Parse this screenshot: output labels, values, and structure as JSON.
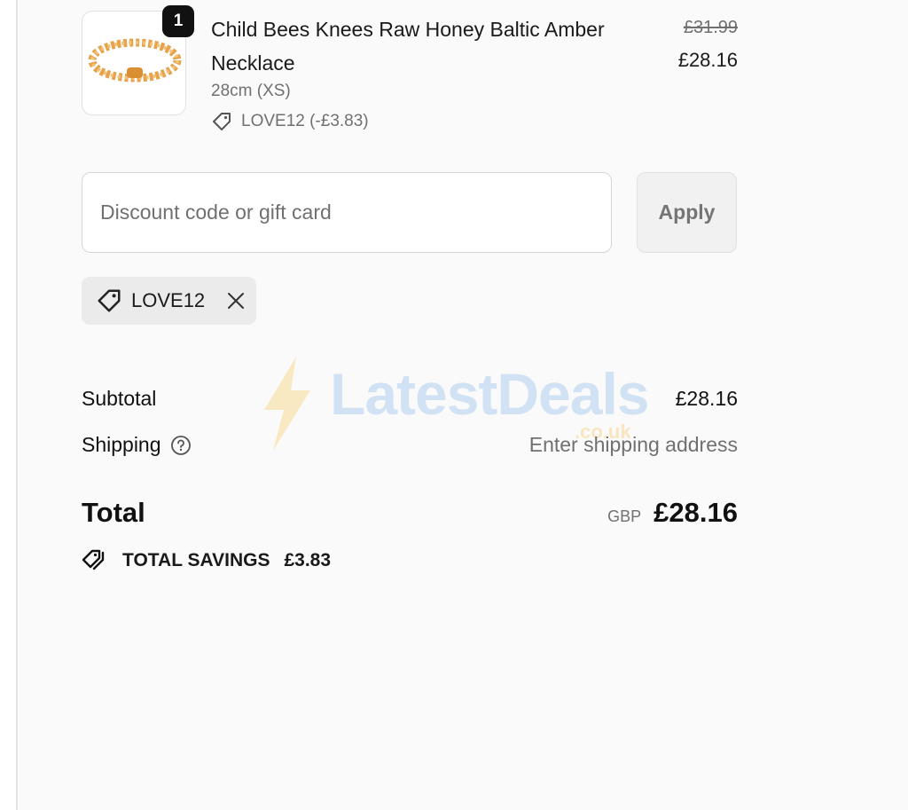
{
  "product": {
    "quantity": "1",
    "title": "Child Bees Knees Raw Honey Baltic Amber Necklace",
    "variant": "28cm (XS)",
    "line_discount": "LOVE12 (-£3.83)",
    "original_price": "£31.99",
    "price": "£28.16",
    "image_icon": "amber-necklace-image"
  },
  "discount": {
    "placeholder": "Discount code or gift card",
    "value": "",
    "apply_label": "Apply",
    "applied_code": "LOVE12"
  },
  "watermark": {
    "name": "LatestDeals",
    "domain": ".co.uk"
  },
  "summary": {
    "subtotal_label": "Subtotal",
    "subtotal_value": "£28.16",
    "shipping_label": "Shipping",
    "shipping_value": "Enter shipping address",
    "total_label": "Total",
    "currency": "GBP",
    "total_value": "£28.16",
    "savings_label": "TOTAL SAVINGS",
    "savings_value": "£3.83"
  },
  "colors": {
    "background": "#fafafa",
    "text": "#1a1a1a",
    "muted": "#707070",
    "badge": "#111111",
    "amber": "#e8a24a"
  }
}
